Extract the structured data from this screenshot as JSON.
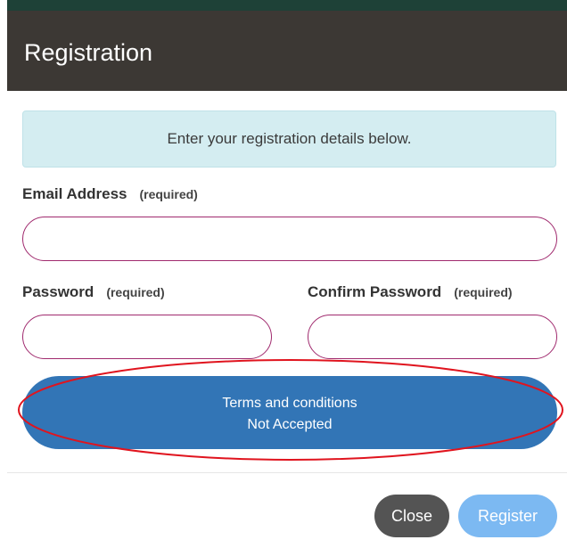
{
  "dialog": {
    "title": "Registration",
    "info_message": "Enter your registration details below."
  },
  "form": {
    "email": {
      "label": "Email Address",
      "required_text": "(required)",
      "value": "",
      "placeholder": ""
    },
    "password": {
      "label": "Password",
      "required_text": "(required)",
      "value": "",
      "placeholder": ""
    },
    "confirm_password": {
      "label": "Confirm Password",
      "required_text": "(required)",
      "value": "",
      "placeholder": ""
    },
    "terms": {
      "line1": "Terms and conditions",
      "line2": "Not Accepted"
    }
  },
  "footer": {
    "close_label": "Close",
    "register_label": "Register"
  },
  "colors": {
    "header_bg": "#3c3834",
    "info_bg": "#d4edf1",
    "field_border": "#a02a6e",
    "terms_bg": "#3275b6",
    "close_bg": "#545454",
    "register_bg": "#7cb9f2",
    "annotation": "#e0141e"
  }
}
